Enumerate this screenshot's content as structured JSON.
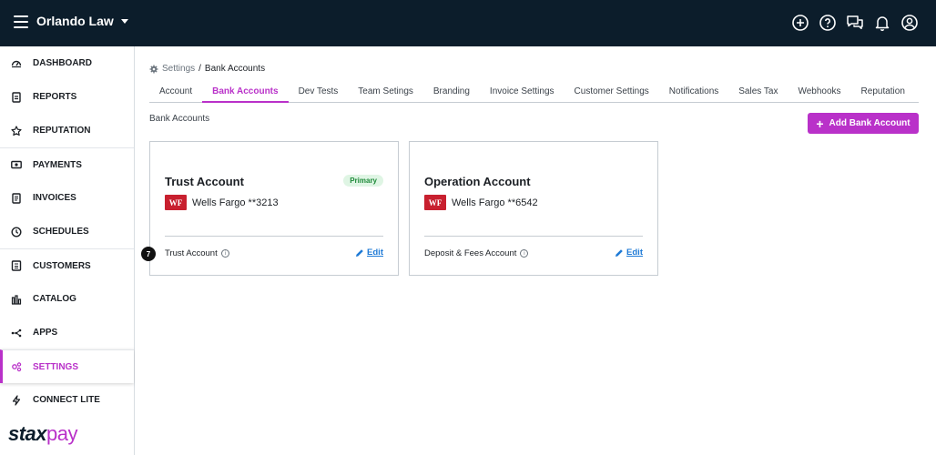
{
  "header": {
    "org_name": "Orlando Law",
    "icons": [
      "plus-circle-icon",
      "help-icon",
      "chat-icon",
      "bell-icon",
      "user-icon"
    ]
  },
  "sidebar": {
    "items": [
      {
        "label": "DASHBOARD",
        "icon": "dashboard-icon"
      },
      {
        "label": "REPORTS",
        "icon": "reports-icon"
      },
      {
        "label": "REPUTATION",
        "icon": "star-icon"
      },
      {
        "label": "PAYMENTS",
        "icon": "payments-icon"
      },
      {
        "label": "INVOICES",
        "icon": "invoice-icon"
      },
      {
        "label": "SCHEDULES",
        "icon": "clock-icon"
      },
      {
        "label": "CUSTOMERS",
        "icon": "customers-icon"
      },
      {
        "label": "CATALOG",
        "icon": "catalog-icon"
      },
      {
        "label": "APPS",
        "icon": "apps-icon"
      },
      {
        "label": "SETTINGS",
        "icon": "settings-icon",
        "active": true
      },
      {
        "label": "CONNECT LITE",
        "icon": "lightning-icon"
      }
    ],
    "logo": {
      "part1": "stax",
      "part2": "pay"
    }
  },
  "breadcrumb": {
    "parent": "Settings",
    "separator": "/",
    "current": "Bank Accounts"
  },
  "tabs": [
    {
      "label": "Account"
    },
    {
      "label": "Bank Accounts",
      "active": true
    },
    {
      "label": "Dev Tests"
    },
    {
      "label": "Team Setings"
    },
    {
      "label": "Branding"
    },
    {
      "label": "Invoice Settings"
    },
    {
      "label": "Customer Settings"
    },
    {
      "label": "Notifications"
    },
    {
      "label": "Sales Tax"
    },
    {
      "label": "Webhooks"
    },
    {
      "label": "Reputation"
    }
  ],
  "main": {
    "section_label": "Bank Accounts",
    "add_button_label": "Add Bank Account",
    "step_badge": "7",
    "cards": [
      {
        "title": "Trust Account",
        "badge": "Primary",
        "bank_logo": "WF",
        "bank": "Wells Fargo **3213",
        "footer": "Trust Account",
        "edit_label": "Edit"
      },
      {
        "title": "Operation Account",
        "bank_logo": "WF",
        "bank": "Wells Fargo **6542",
        "footer": "Deposit & Fees Account",
        "edit_label": "Edit"
      }
    ]
  },
  "colors": {
    "accent": "#b931c9",
    "topbar": "#0c1d2b",
    "link": "#1e7ad6",
    "wf_red": "#c8202f"
  }
}
